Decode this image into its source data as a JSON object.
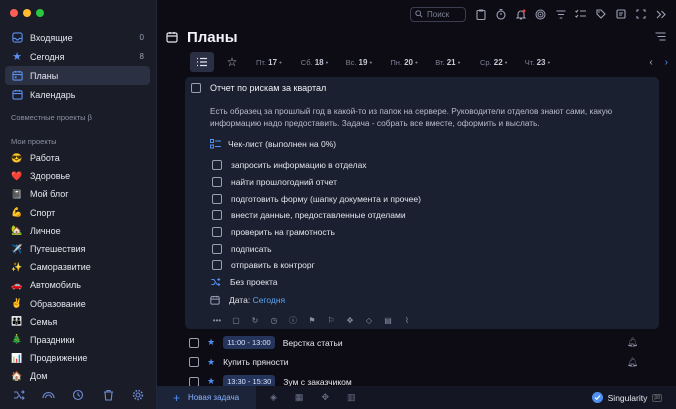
{
  "window": {
    "traffic_colors": [
      "#fe5f57",
      "#febc2e",
      "#28c840"
    ]
  },
  "sidebar": {
    "nav": [
      {
        "label": "Входящие",
        "count": "0",
        "icon": "inbox-icon"
      },
      {
        "label": "Сегодня",
        "count": "8",
        "icon": "star-icon"
      },
      {
        "label": "Планы",
        "count": "",
        "icon": "calendar-plan-icon",
        "active": true
      },
      {
        "label": "Календарь",
        "count": "",
        "icon": "calendar-icon"
      }
    ],
    "shared_projects_label": "Совместные проекты β",
    "my_projects_label": "Мои проекты",
    "projects": [
      {
        "label": "Работа",
        "emoji": "😎"
      },
      {
        "label": "Здоровье",
        "emoji": "❤️"
      },
      {
        "label": "Мой блог",
        "emoji": "📓"
      },
      {
        "label": "Спорт",
        "emoji": "💪"
      },
      {
        "label": "Личное",
        "emoji": "🏡"
      },
      {
        "label": "Путешествия",
        "emoji": "✈️"
      },
      {
        "label": "Саморазвитие",
        "emoji": "✨"
      },
      {
        "label": "Автомобиль",
        "emoji": "🚗"
      },
      {
        "label": "Образование",
        "emoji": "✌️"
      },
      {
        "label": "Семья",
        "emoji": "👪"
      },
      {
        "label": "Праздники",
        "emoji": "🎄"
      },
      {
        "label": "Продвижение",
        "emoji": "📊"
      },
      {
        "label": "Дом",
        "emoji": "🏠"
      }
    ]
  },
  "topbar": {
    "search_placeholder": "Поиск"
  },
  "page": {
    "title": "Планы"
  },
  "days": [
    {
      "dow": "Пт.",
      "num": "17"
    },
    {
      "dow": "Сб.",
      "num": "18"
    },
    {
      "dow": "Вс.",
      "num": "19"
    },
    {
      "dow": "Пн.",
      "num": "20"
    },
    {
      "dow": "Вт.",
      "num": "21"
    },
    {
      "dow": "Ср.",
      "num": "22"
    },
    {
      "dow": "Чт.",
      "num": "23"
    }
  ],
  "task": {
    "title": "Отчет по рискам за квартал",
    "description": "Есть образец за прошлый год в какой-то из папок на сервере. Руководители отделов знают сами, какую информацию надо предоставить. Задача - собрать все вместе, оформить и выслать.",
    "checklist_title": "Чек-лист (выполнен на 0%)",
    "checklist": [
      "запросить информацию в отделах",
      "найти прошлогодний отчет",
      "подготовить форму (шапку документа и прочее)",
      "внести данные, предоставленные отделами",
      "проверить на грамотность",
      "подписать",
      "отправить в контрорг"
    ],
    "project": "Без проекта",
    "date_label": "Дата:",
    "date_value": "Сегодня"
  },
  "rows": [
    {
      "time": "11:00 - 13:00",
      "title": "Верстка статьи"
    },
    {
      "time": "",
      "title": "Купить пряности"
    },
    {
      "time": "13:30 - 15:30",
      "title": "Зум с заказчиком"
    }
  ],
  "bottombar": {
    "new_task": "Новая задача",
    "brand": "Singularity",
    "brand_tag": "β8"
  }
}
